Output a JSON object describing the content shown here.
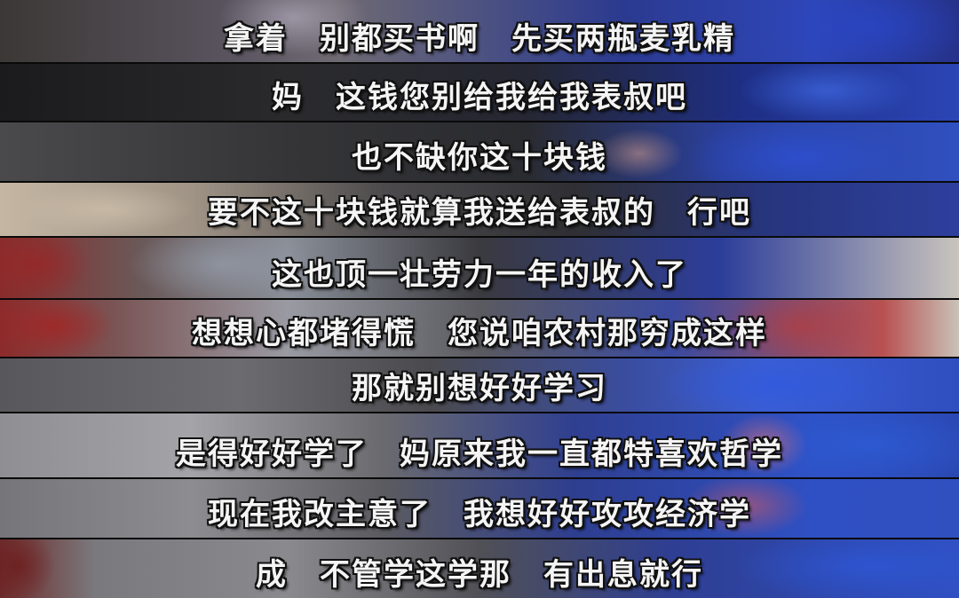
{
  "subtitles": [
    "拿着　别都买书啊　先买两瓶麦乳精",
    "妈　这钱您别给我给我表叔吧",
    "也不缺你这十块钱",
    "要不这十块钱就算我送给表叔的　行吧",
    "这也顶一壮劳力一年的收入了",
    "想想心都堵得慌　您说咱农村那穷成这样",
    "那就别想好好学习",
    "是得好好学了　妈原来我一直都特喜欢哲学",
    "现在我改主意了　我想好好攻攻经济学",
    "成　不管学这学那　有出息就行"
  ],
  "colors": {
    "subtitle_text": "#f4f4f4",
    "subtitle_outline": "#111111",
    "strip_divider": "#0a0a0a"
  }
}
